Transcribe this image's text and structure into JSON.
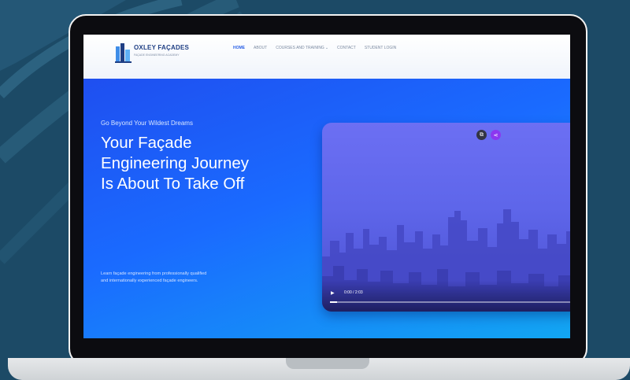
{
  "nav": {
    "brand_name": "OXLEY FAÇADES",
    "brand_tagline": "FAÇADE ENGINEERING ACADEMY",
    "items": [
      {
        "label": "HOME",
        "active": true
      },
      {
        "label": "ABOUT",
        "active": false
      },
      {
        "label": "COURSES AND TRAINING",
        "active": false,
        "dropdown": true
      },
      {
        "label": "CONTACT",
        "active": false
      },
      {
        "label": "STUDENT LOGIN",
        "active": false
      }
    ]
  },
  "hero": {
    "tagline": "Go Beyond Your Wildest Dreams",
    "headline_lines": [
      "Your Façade",
      "Engineering Journey",
      "Is About To Take Off"
    ],
    "subtext_lines": [
      "Learn façade engineering from professionally qualified",
      "and internationally experienced façade engineers."
    ]
  },
  "video": {
    "time": "0:00 / 2:03",
    "progress": 0.0,
    "buttons": [
      "copy-icon",
      "share-icon"
    ]
  },
  "colors": {
    "page_background": "#1c4a66",
    "hero_start": "#1f4ff0",
    "hero_end": "#12a6f2",
    "accent": "#2a60e6",
    "share_button": "#8b38f0"
  }
}
